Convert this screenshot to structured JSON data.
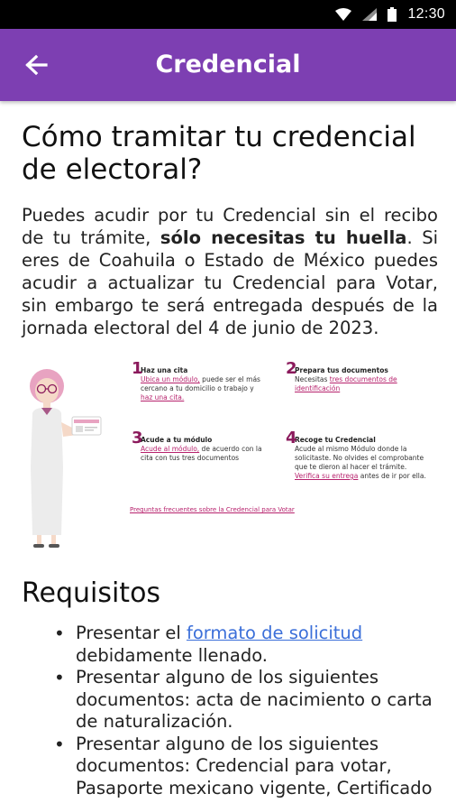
{
  "status_bar": {
    "time": "12:30",
    "icons": [
      "wifi-icon",
      "signal-icon",
      "battery-icon"
    ]
  },
  "app_bar": {
    "title": "Credencial",
    "back_icon": "arrow-back-icon",
    "color": "#7d3fb2"
  },
  "main": {
    "title": "Cómo tramitar tu credencial de electoral?",
    "intro": {
      "part1": "Puedes acudir por tu Credencial sin el recibo de tu trámite, ",
      "bold": "sólo necesitas tu huella",
      "part2": ". Si eres de Coahuila o Estado de México puedes acudir a actualizar tu Credencial para Votar, sin embargo te será entregada después de la jornada electoral del 4 de junio de 2023."
    },
    "infographic": {
      "steps": [
        {
          "num": "1",
          "title": "Haz una cita",
          "link": "Ubica un módulo,",
          "text": " puede ser el más cercano a tu domicilio o trabajo y ",
          "link2": "haz una cita."
        },
        {
          "num": "2",
          "title": "Prepara tus documentos",
          "text": "Necesitas ",
          "link": "tres documentos de identificación"
        },
        {
          "num": "3",
          "title": "Acude a tu módulo",
          "link": "Acude al módulo,",
          "text": " de acuerdo con la cita con tus tres documentos"
        },
        {
          "num": "4",
          "title": "Recoge tu Credencial",
          "text": "Acude al mismo Módulo donde la solicitaste. No olvides el comprobante que te dieron al hacer el trámite. ",
          "link": "Verifica su entrega",
          "text2": " antes de ir por ella."
        }
      ],
      "faq_link": "Preguntas frecuentes sobre la Credencial para Votar"
    },
    "requirements": {
      "title": "Requisitos",
      "items": [
        {
          "before": "Presentar el ",
          "link": "formato de solicitud",
          "after": " debidamente llenado."
        },
        {
          "before": "Presentar alguno de los siguientes documentos: acta de nacimiento o carta de naturalización.",
          "link": "",
          "after": ""
        },
        {
          "before": "Presentar alguno de los siguientes documentos: Credencial para votar, Pasaporte mexicano vigente, Certificado",
          "link": "",
          "after": ""
        }
      ]
    }
  }
}
